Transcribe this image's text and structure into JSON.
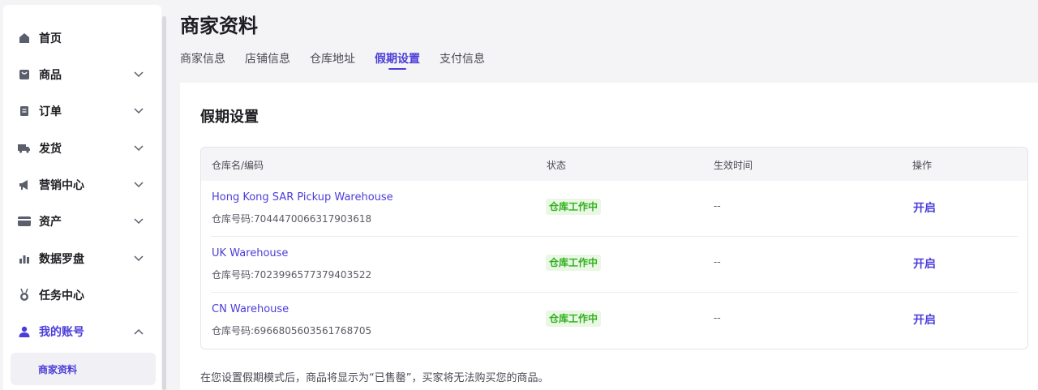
{
  "sidebar": {
    "items": [
      {
        "label": "首页",
        "icon": "home-icon",
        "has_chevron": false
      },
      {
        "label": "商品",
        "icon": "bag-icon",
        "has_chevron": true
      },
      {
        "label": "订单",
        "icon": "document-icon",
        "has_chevron": true
      },
      {
        "label": "发货",
        "icon": "truck-icon",
        "has_chevron": true
      },
      {
        "label": "营销中心",
        "icon": "megaphone-icon",
        "has_chevron": true
      },
      {
        "label": "资产",
        "icon": "card-icon",
        "has_chevron": true
      },
      {
        "label": "数据罗盘",
        "icon": "bar-chart-icon",
        "has_chevron": true
      },
      {
        "label": "任务中心",
        "icon": "medal-icon",
        "has_chevron": false
      },
      {
        "label": "我的账号",
        "icon": "user-icon",
        "has_chevron": true,
        "expanded": true
      }
    ],
    "sub_items": [
      {
        "label": "商家资料"
      }
    ]
  },
  "header": {
    "title": "商家资料",
    "tabs": [
      "商家信息",
      "店铺信息",
      "仓库地址",
      "假期设置",
      "支付信息"
    ],
    "active_tab": "假期设置"
  },
  "card": {
    "title": "假期设置",
    "columns": [
      "仓库名/编码",
      "状态",
      "生效时间",
      "操作"
    ],
    "rows": [
      {
        "name": "Hong Kong SAR Pickup Warehouse",
        "code": "仓库号码:7044470066317903618",
        "status": "仓库工作中",
        "time": "--",
        "action": "开启"
      },
      {
        "name": "UK Warehouse",
        "code": "仓库号码:7023996577379403522",
        "status": "仓库工作中",
        "time": "--",
        "action": "开启"
      },
      {
        "name": "CN Warehouse",
        "code": "仓库号码:6966805603561768705",
        "status": "仓库工作中",
        "time": "--",
        "action": "开启"
      }
    ],
    "note": "在您设置假期模式后，商品将显示为“已售罄”，买家将无法购买您的商品。"
  },
  "colors": {
    "accent": "#4b3dd9",
    "status_green": "#2fb01c",
    "status_bg": "#eaf7e4"
  }
}
